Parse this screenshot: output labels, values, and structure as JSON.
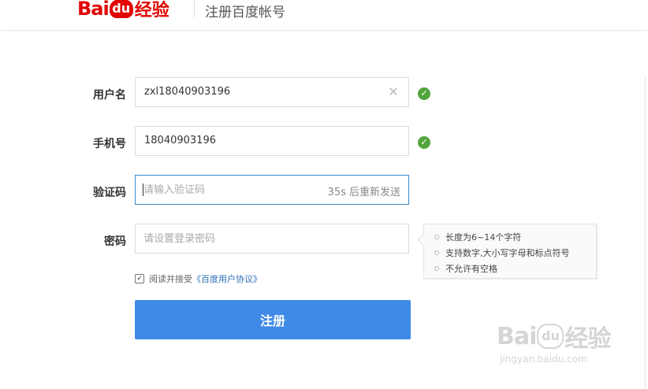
{
  "header": {
    "logo_bai": "Bai",
    "logo_du": "du",
    "logo_jingyan": "经验",
    "title": "注册百度帐号"
  },
  "form": {
    "username": {
      "label": "用户名",
      "value": "zxl18040903196",
      "clear_icon": "✕",
      "status_icon": "✓"
    },
    "phone": {
      "label": "手机号",
      "value": "18040903196",
      "status_icon": "✓"
    },
    "code": {
      "label": "验证码",
      "placeholder": "请输入验证码",
      "resend": "35s 后重新发送"
    },
    "password": {
      "label": "密码",
      "placeholder": "请设置登录密码"
    },
    "password_tips": [
      "长度为6~14个字符",
      "支持数字,大小写字母和标点符号",
      "不允许有空格"
    ],
    "agree": {
      "checked": true,
      "check_mark": "✓",
      "text": "阅读并接受",
      "link": "《百度用户协议》"
    },
    "submit_label": "注册"
  },
  "watermark": {
    "bai": "Bai",
    "du": "du",
    "jingyan": "经验",
    "url": "jingyan.baidu.com"
  },
  "colors": {
    "brand_red": "#e10602",
    "primary_button": "#3f8ae6",
    "success": "#52a43c",
    "link": "#2a6fb8"
  },
  "icons": {
    "username_clear": "close-icon",
    "field_ok": "check-circle-icon",
    "tip_bullet": "circle-bullet-icon",
    "agree": "checkbox-icon"
  }
}
